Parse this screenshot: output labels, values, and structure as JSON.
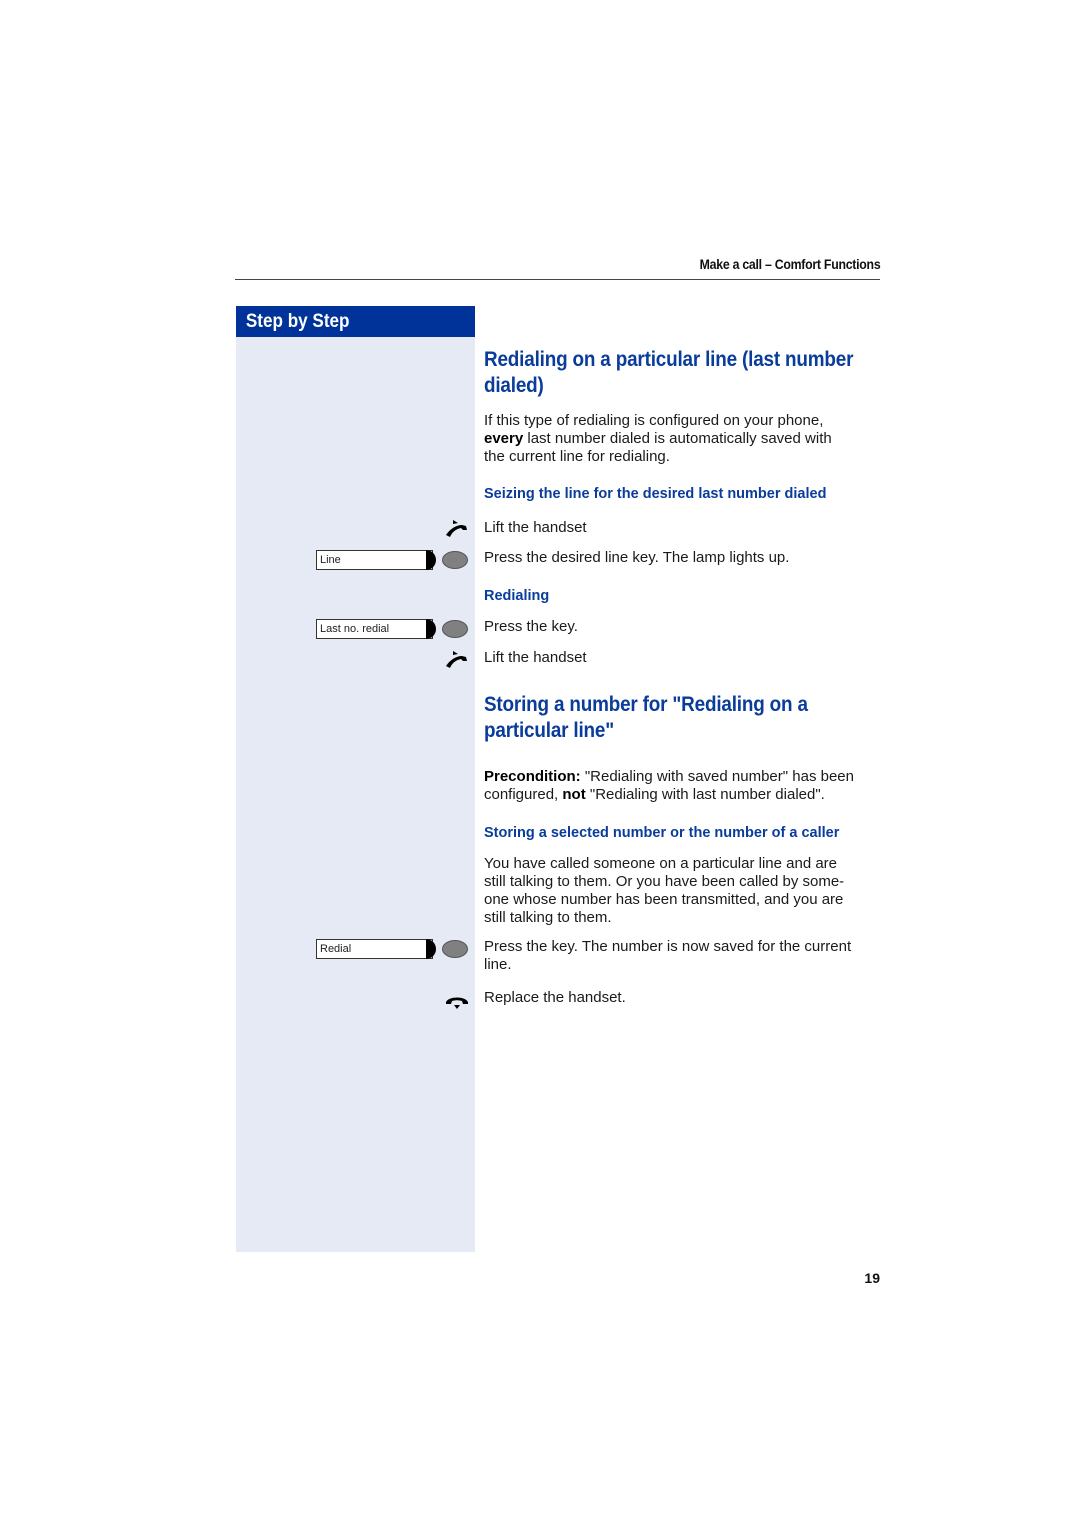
{
  "header": {
    "title": "Make a call – Comfort Functions"
  },
  "sidebar": {
    "title": "Step by Step",
    "keys": [
      {
        "label": "Line"
      },
      {
        "label": "Last no. redial"
      },
      {
        "label": "Redial"
      }
    ],
    "icons": [
      "lift-handset-icon",
      "lift-handset-icon",
      "replace-handset-icon"
    ]
  },
  "section1": {
    "heading_line1": "Redialing on a particular line (last number",
    "heading_line2": "dialed)",
    "intro_line1": "If this type of redialing is configured on your phone,",
    "intro_bold": "every",
    "intro_line2_rest": " last number dialed is automatically saved with",
    "intro_line3": "the current line for redialing.",
    "sub1": "Seizing the line for the desired last number dialed",
    "step_lift1": "Lift the handset",
    "step_press_line": "Press the desired line key. The lamp lights up.",
    "sub2": "Redialing",
    "step_press_key": "Press the key.",
    "step_lift2": "Lift the handset"
  },
  "section2": {
    "heading_line1": "Storing a number for \"Redialing on a",
    "heading_line2": "particular line\"",
    "precondition_label": "Precondition:",
    "precondition_text1": " \"Redialing with saved number\" has been",
    "precondition_text2a": "configured, ",
    "precondition_not": "not",
    "precondition_text2b": " \"Redialing with last number dialed\".",
    "sub1": "Storing a selected number or the number of a caller",
    "body_line1": "You have called someone on a particular line and are",
    "body_line2": "still talking to them. Or you have been called by some-",
    "body_line3": "one whose number has been transmitted, and you are",
    "body_line4": "still talking to them.",
    "step_press_line1": "Press the key. The number is now saved for the current",
    "step_press_line2": "line.",
    "step_replace": "Replace the handset."
  },
  "footer": {
    "page_number": "19"
  }
}
